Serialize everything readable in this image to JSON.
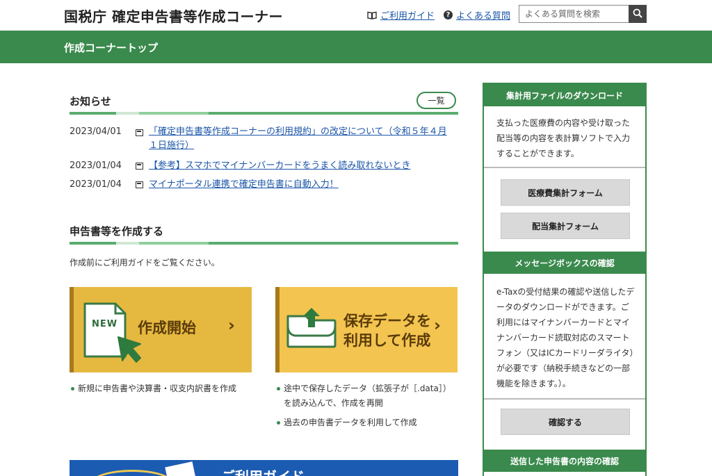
{
  "header": {
    "site_title": "国税庁 確定申告書等作成コーナー",
    "guide_link": "ご利用ガイド",
    "faq_link": "よくある質問",
    "search_placeholder": "よくある質問を検索",
    "help_icon_char": "?"
  },
  "band": {
    "title": "作成コーナートップ"
  },
  "news": {
    "heading": "お知らせ",
    "list_button": "一覧",
    "items": [
      {
        "date": "2023/04/01",
        "text": "「確定申告書等作成コーナーの利用規約」の改定について（令和５年４月１日施行）"
      },
      {
        "date": "2023/01/04",
        "text": "【参考】スマホでマイナンバーカードをうまく読み取れないとき"
      },
      {
        "date": "2023/01/04",
        "text": "マイナポータル連携で確定申告書に自動入力！"
      }
    ]
  },
  "create": {
    "heading": "申告書等を作成する",
    "intro": "作成前にご利用ガイドをご覧ください。",
    "start": {
      "new_tag": "NEW",
      "label": "作成開始",
      "bullets": [
        "新規に申告書や決算書・収支内訳書を作成"
      ]
    },
    "load": {
      "label_line1": "保存データを",
      "label_line2": "利用して作成",
      "bullets": [
        "途中で保存したデータ（拡張子が［.data］）を読み込んで、作成を再開",
        "過去の申告書データを利用して作成"
      ]
    },
    "chevron": "›"
  },
  "guide_banner": {
    "text": "ご利用ガイド"
  },
  "sidebar": {
    "sections": [
      {
        "title": "集計用ファイルのダウンロード",
        "text": "支払った医療費の内容や受け取った配当等の内容を表計算ソフトで入力することができます。",
        "buttons": [
          "医療費集計フォーム",
          "配当集計フォーム"
        ]
      },
      {
        "title": "メッセージボックスの確認",
        "text": "e-Taxの受付結果の確認や送信したデータのダウンロードができます。ご利用にはマイナンバーカードとマイナンバーカード読取対応のスマートフォン（又はICカードリーダライタ）が必要です（納税手続きなどの一部機能を除きます。）。",
        "buttons": [
          "確認する"
        ]
      },
      {
        "title": "送信した申告書の内容の確認",
        "text": "",
        "buttons": []
      }
    ]
  },
  "colors": {
    "brand_green": "#3a8a4d",
    "link_blue": "#1a55a8",
    "start_yellow": "#e5b940",
    "load_yellow": "#f3c44f"
  }
}
